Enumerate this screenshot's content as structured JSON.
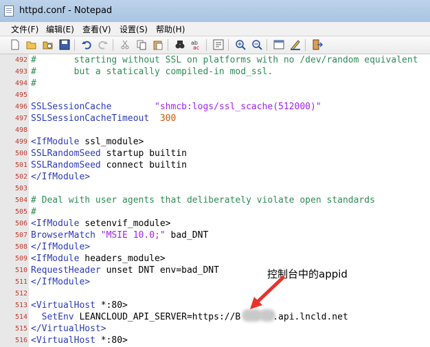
{
  "window": {
    "title": "httpd.conf - Notepad"
  },
  "menu": [
    "文件(F)",
    "编辑(E)",
    "查看(V)",
    "设置(S)",
    "帮助(H)"
  ],
  "toolbar_icons": [
    "new-icon",
    "open-icon",
    "open-folder-icon",
    "save-icon",
    "undo-icon",
    "redo-icon",
    "cut-icon",
    "copy-icon",
    "paste-icon",
    "find-icon",
    "replace-icon",
    "wrap-icon",
    "zoom-in-icon",
    "zoom-out-icon",
    "view-icon",
    "edit-icon",
    "exit-icon"
  ],
  "code_lines": [
    {
      "num": "492",
      "parts": [
        {
          "t": "#       starting without SSL on platforms with no /dev/random equivalent",
          "c": "comment"
        }
      ]
    },
    {
      "num": "493",
      "parts": [
        {
          "t": "#       but a statically compiled-in mod_ssl.",
          "c": "comment"
        }
      ]
    },
    {
      "num": "494",
      "parts": [
        {
          "t": "#",
          "c": "comment"
        }
      ]
    },
    {
      "num": "495",
      "parts": []
    },
    {
      "num": "496",
      "parts": [
        {
          "t": "SSLSessionCache        ",
          "c": "key"
        },
        {
          "t": "\"shmcb:logs/ssl_scache(512000)\"",
          "c": "str"
        }
      ]
    },
    {
      "num": "497",
      "parts": [
        {
          "t": "SSLSessionCacheTimeout  ",
          "c": "key"
        },
        {
          "t": "300",
          "c": "num"
        }
      ]
    },
    {
      "num": "498",
      "parts": []
    },
    {
      "num": "499",
      "parts": [
        {
          "t": "<IfModule",
          "c": "key"
        },
        {
          "t": " ssl_module>",
          "c": "plain"
        }
      ]
    },
    {
      "num": "500",
      "parts": [
        {
          "t": "SSLRandomSeed",
          "c": "key"
        },
        {
          "t": " startup builtin",
          "c": "plain"
        }
      ]
    },
    {
      "num": "501",
      "parts": [
        {
          "t": "SSLRandomSeed",
          "c": "key"
        },
        {
          "t": " connect builtin",
          "c": "plain"
        }
      ]
    },
    {
      "num": "502",
      "parts": [
        {
          "t": "</IfModule>",
          "c": "key"
        }
      ]
    },
    {
      "num": "503",
      "parts": []
    },
    {
      "num": "504",
      "parts": [
        {
          "t": "# Deal with user agents that deliberately violate open standards",
          "c": "comment"
        }
      ]
    },
    {
      "num": "505",
      "parts": [
        {
          "t": "#",
          "c": "comment"
        }
      ]
    },
    {
      "num": "506",
      "parts": [
        {
          "t": "<IfModule",
          "c": "key"
        },
        {
          "t": " setenvif_module>",
          "c": "plain"
        }
      ]
    },
    {
      "num": "507",
      "parts": [
        {
          "t": "BrowserMatch",
          "c": "key"
        },
        {
          "t": " \"MSIE 10.0;\"",
          "c": "str"
        },
        {
          "t": " bad_DNT",
          "c": "plain"
        }
      ]
    },
    {
      "num": "508",
      "parts": [
        {
          "t": "</IfModule>",
          "c": "key"
        }
      ]
    },
    {
      "num": "509",
      "parts": [
        {
          "t": "<IfModule",
          "c": "key"
        },
        {
          "t": " headers_module>",
          "c": "plain"
        }
      ]
    },
    {
      "num": "510",
      "parts": [
        {
          "t": "RequestHeader",
          "c": "key"
        },
        {
          "t": " unset DNT env=bad_DNT",
          "c": "plain"
        }
      ]
    },
    {
      "num": "511",
      "parts": [
        {
          "t": "</IfModule>",
          "c": "key"
        }
      ]
    },
    {
      "num": "512",
      "parts": []
    },
    {
      "num": "513",
      "parts": [
        {
          "t": "<VirtualHost",
          "c": "key"
        },
        {
          "t": " *:80>",
          "c": "plain"
        }
      ]
    },
    {
      "num": "514",
      "parts": [
        {
          "t": "  SetEnv",
          "c": "key"
        },
        {
          "t": " LEANCLOUD_API_SERVER=https://B     T.api.lncld.net",
          "c": "plain"
        }
      ]
    },
    {
      "num": "515",
      "parts": [
        {
          "t": "</VirtualHost>",
          "c": "key"
        }
      ]
    },
    {
      "num": "516",
      "parts": [
        {
          "t": "<VirtualHost",
          "c": "key"
        },
        {
          "t": " *:80>",
          "c": "plain"
        }
      ]
    }
  ],
  "annotation": {
    "text": "控制台中的appid",
    "arrow_color": "#e8332a"
  }
}
